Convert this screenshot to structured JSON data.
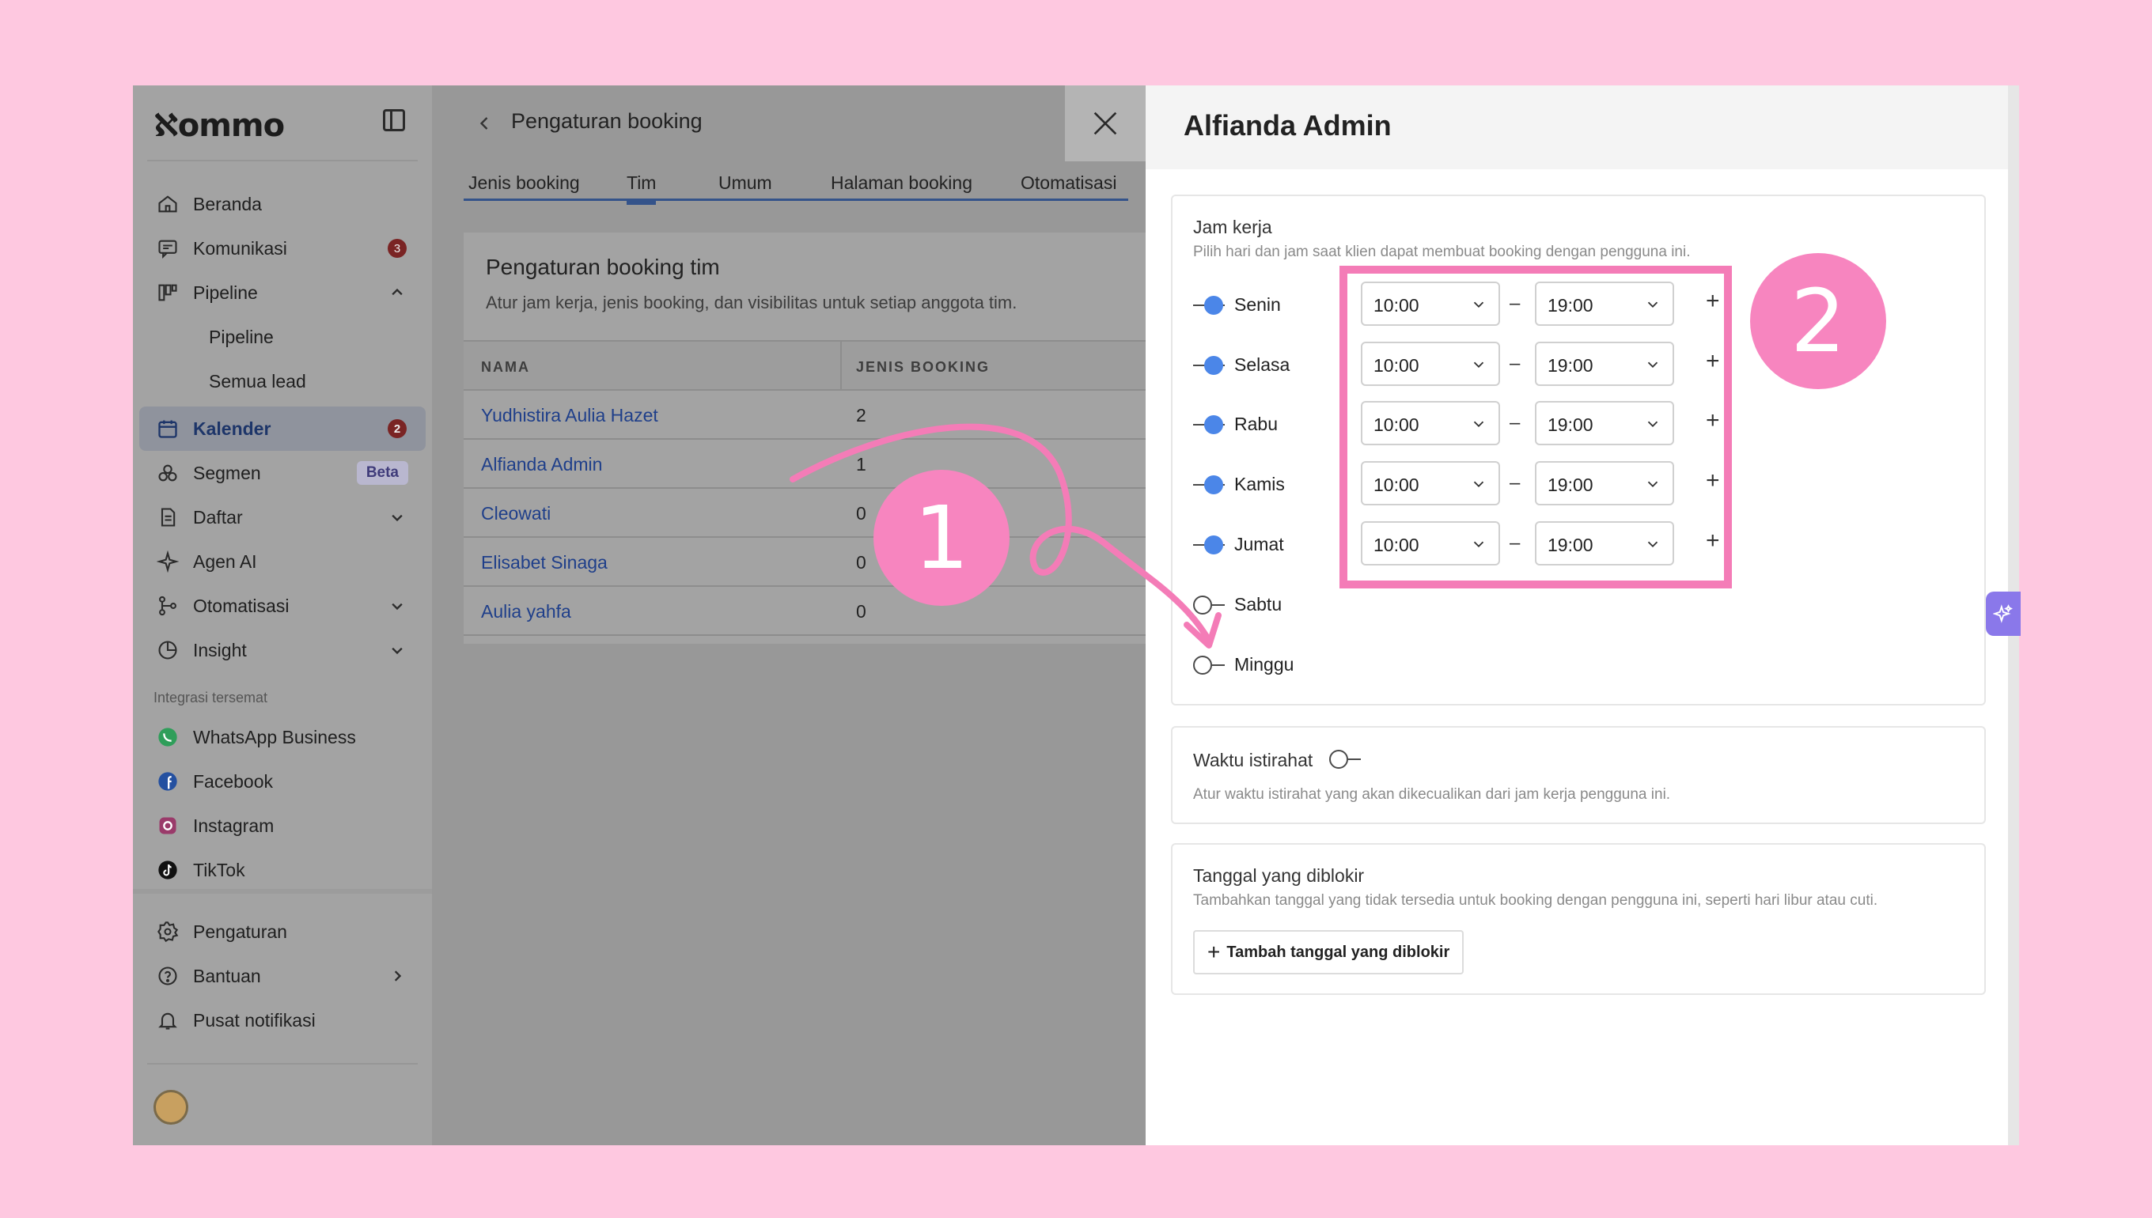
{
  "brand": {
    "logo": "ℵommo"
  },
  "sidebar": {
    "items": [
      {
        "label": "Beranda",
        "icon": "home-icon"
      },
      {
        "label": "Komunikasi",
        "icon": "chat-icon",
        "badge": "3"
      },
      {
        "label": "Pipeline",
        "icon": "pipeline-icon",
        "expanded": true
      },
      {
        "label": "Pipeline",
        "sub": true
      },
      {
        "label": "Semua lead",
        "sub": true
      },
      {
        "label": "Kalender",
        "icon": "calendar-icon",
        "badge": "2",
        "active": true
      },
      {
        "label": "Segmen",
        "icon": "segment-icon",
        "tag": "Beta"
      },
      {
        "label": "Daftar",
        "icon": "list-icon"
      },
      {
        "label": "Agen AI",
        "icon": "sparkle-icon"
      },
      {
        "label": "Otomatisasi",
        "icon": "automation-icon"
      },
      {
        "label": "Insight",
        "icon": "insight-icon"
      }
    ],
    "integrations_heading": "Integrasi tersemat",
    "integrations": [
      {
        "label": "WhatsApp Business",
        "icon": "whatsapp-icon",
        "color": "#25d366"
      },
      {
        "label": "Facebook",
        "icon": "facebook-icon",
        "color": "#1877f2"
      },
      {
        "label": "Instagram",
        "icon": "instagram-icon",
        "color": "#d62976"
      },
      {
        "label": "TikTok",
        "icon": "tiktok-icon",
        "color": "#111111"
      }
    ],
    "bottom": [
      {
        "label": "Pengaturan",
        "icon": "gear-icon"
      },
      {
        "label": "Bantuan",
        "icon": "help-icon"
      },
      {
        "label": "Pusat notifikasi",
        "icon": "bell-icon"
      }
    ]
  },
  "content": {
    "title": "Pengaturan booking",
    "tabs": [
      "Jenis booking",
      "Tim",
      "Umum",
      "Halaman booking",
      "Otomatisasi"
    ],
    "active_tab": "Tim",
    "team_title": "Pengaturan booking tim",
    "team_subtitle": "Atur jam kerja, jenis booking, dan visibilitas untuk setiap anggota tim.",
    "columns": [
      "NAMA",
      "JENIS BOOKING"
    ],
    "rows": [
      {
        "name": "Yudhistira Aulia Hazet",
        "count": "2"
      },
      {
        "name": "Alfianda Admin",
        "count": "1"
      },
      {
        "name": "Cleowati",
        "count": "0"
      },
      {
        "name": "Elisabet Sinaga",
        "count": "0"
      },
      {
        "name": "Aulia yahfa",
        "count": "0"
      }
    ]
  },
  "panel": {
    "title": "Alfianda Admin",
    "work_hours": {
      "title": "Jam kerja",
      "subtitle": "Pilih hari dan jam saat klien dapat membuat booking dengan pengguna ini.",
      "days": [
        {
          "label": "Senin",
          "on": true,
          "from": "10:00",
          "to": "19:00"
        },
        {
          "label": "Selasa",
          "on": true,
          "from": "10:00",
          "to": "19:00"
        },
        {
          "label": "Rabu",
          "on": true,
          "from": "10:00",
          "to": "19:00"
        },
        {
          "label": "Kamis",
          "on": true,
          "from": "10:00",
          "to": "19:00"
        },
        {
          "label": "Jumat",
          "on": true,
          "from": "10:00",
          "to": "19:00"
        },
        {
          "label": "Sabtu",
          "on": false
        },
        {
          "label": "Minggu",
          "on": false
        }
      ],
      "separator": "–",
      "add": "+"
    },
    "break": {
      "title": "Waktu istirahat",
      "subtitle": "Atur waktu istirahat yang akan dikecualikan dari jam kerja pengguna ini."
    },
    "blocked": {
      "title": "Tanggal yang diblokir",
      "subtitle": "Tambahkan tanggal yang tidak tersedia untuk booking dengan pengguna ini, seperti hari libur atau cuti.",
      "button": "Tambah tanggal yang diblokir"
    }
  },
  "annotations": {
    "step1": "1",
    "step2": "2",
    "color": "#f785bf"
  }
}
